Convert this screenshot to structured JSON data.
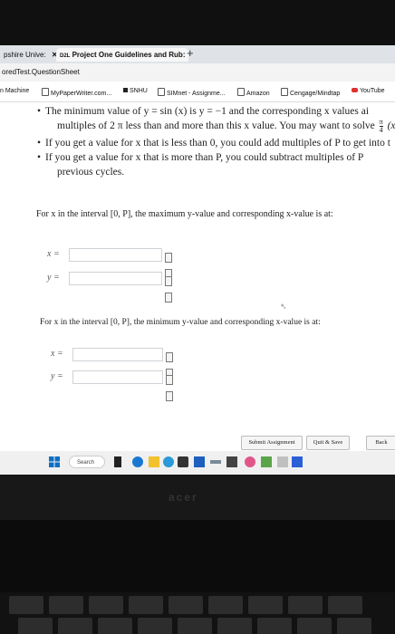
{
  "browser": {
    "tabs": [
      {
        "label": "pshire Unive:",
        "close": "✕"
      },
      {
        "label": "Project One Guidelines and Rub:",
        "prefix": "D2L",
        "close": "✕"
      }
    ],
    "new_tab": "+",
    "address": "oredTest.QuestionSheet",
    "bookmarks": [
      {
        "label": "n Machine",
        "icon": "none"
      },
      {
        "label": "MyPaperWriter.com...",
        "icon": "page-icon"
      },
      {
        "label": "SNHU",
        "icon": "square-icon"
      },
      {
        "label": "SIMnet - Assignme...",
        "icon": "page-icon"
      },
      {
        "label": "Amazon",
        "icon": "page-icon"
      },
      {
        "label": "Cengage/Mindtap",
        "icon": "page-icon"
      },
      {
        "label": "YouTube",
        "icon": "youtube-icon"
      }
    ]
  },
  "question": {
    "bullet_1_line_1": "The minimum value of y = sin (x) is y = −1 and the corresponding x values ai",
    "bullet_1_line_2": "multiples of 2 π less than and more than this x value. You may want to solve",
    "bullet_1_tail": "(x",
    "bullet_1_frac_num": "π",
    "bullet_1_frac_den": "4",
    "bullet_2": "If you get a value for x that is less than 0, you could add multiples of P to get into t",
    "bullet_3_line_1": "If you get a value for x that is more than P, you could subtract multiples of P",
    "bullet_3_line_2": "previous cycles.",
    "bullet_symbol": "•",
    "part_max_prompt": "For x in the interval [0, P], the maximum y-value and corresponding x-value is at:",
    "part_min_prompt": "For x in the interval [0, P], the minimum y-value and corresponding x-value is at:",
    "label_x": "x =",
    "label_y": "y ="
  },
  "answers": {
    "max_x": "",
    "max_y": "",
    "min_x": "",
    "min_y": ""
  },
  "actions": {
    "submit": "Submit Assignment",
    "quit": "Quit & Save",
    "back": "Back"
  },
  "taskbar": {
    "search_label": "Search"
  },
  "colors": {
    "accent": "#0b6fc4",
    "input_border": "#cfd3d7"
  }
}
